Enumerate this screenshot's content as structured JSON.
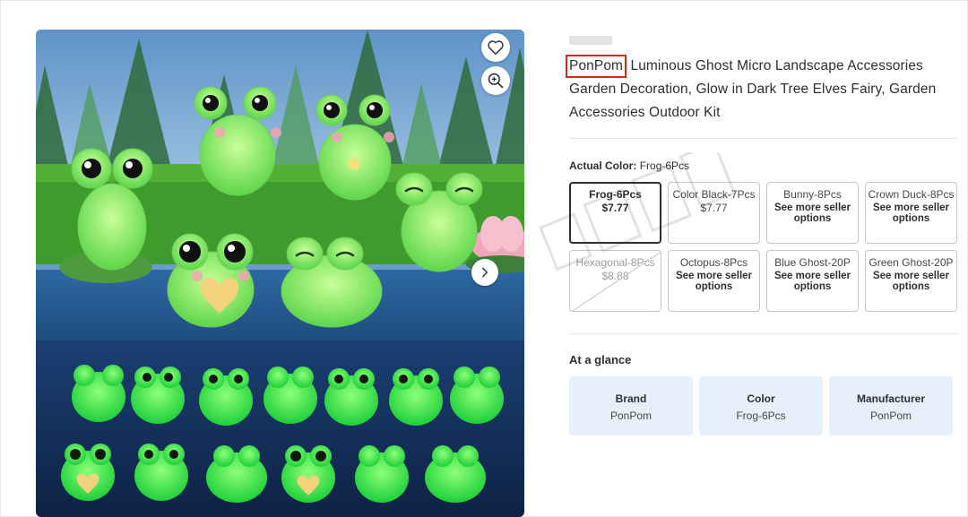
{
  "product": {
    "brand": "PonPom",
    "title_rest": " Luminous Ghost Micro Landscape Accessories Garden Decoration, Glow in Dark Tree Elves Fairy, Garden Accessories Outdoor Kit"
  },
  "image_controls": {
    "favorite_icon": "heart-outline-icon",
    "zoom_icon": "zoom-in-icon",
    "next_icon": "chevron-right-icon"
  },
  "variant": {
    "label": "Actual Color:",
    "selected_value": "Frog-6Pcs",
    "options": [
      {
        "name": "Frog-6Pcs",
        "price": "$7.77",
        "state": "selected"
      },
      {
        "name": "Color Black-7Pcs",
        "price": "$7.77",
        "state": "available"
      },
      {
        "name": "Bunny-8Pcs",
        "note": "See more seller options",
        "state": "available"
      },
      {
        "name": "Crown Duck-8Pcs",
        "note": "See more seller options",
        "state": "available"
      },
      {
        "name": "Hexagonal-8Pcs",
        "price": "$8.88",
        "state": "unavailable"
      },
      {
        "name": "Octopus-8Pcs",
        "note": "See more seller options",
        "state": "available"
      },
      {
        "name": "Blue Ghost-20P",
        "note": "See more seller options",
        "state": "available"
      },
      {
        "name": "Green Ghost-20P",
        "note": "See more seller options",
        "state": "available"
      }
    ]
  },
  "at_a_glance": {
    "title": "At a glance",
    "cards": [
      {
        "key": "Brand",
        "value": "PonPom"
      },
      {
        "key": "Color",
        "value": "Frog-6Pcs"
      },
      {
        "key": "Manufacturer",
        "value": "PonPom"
      }
    ]
  },
  "colors": {
    "highlight_border": "#d9261c",
    "glance_card_bg": "#e6f0fb",
    "text": "#2e2f32"
  }
}
